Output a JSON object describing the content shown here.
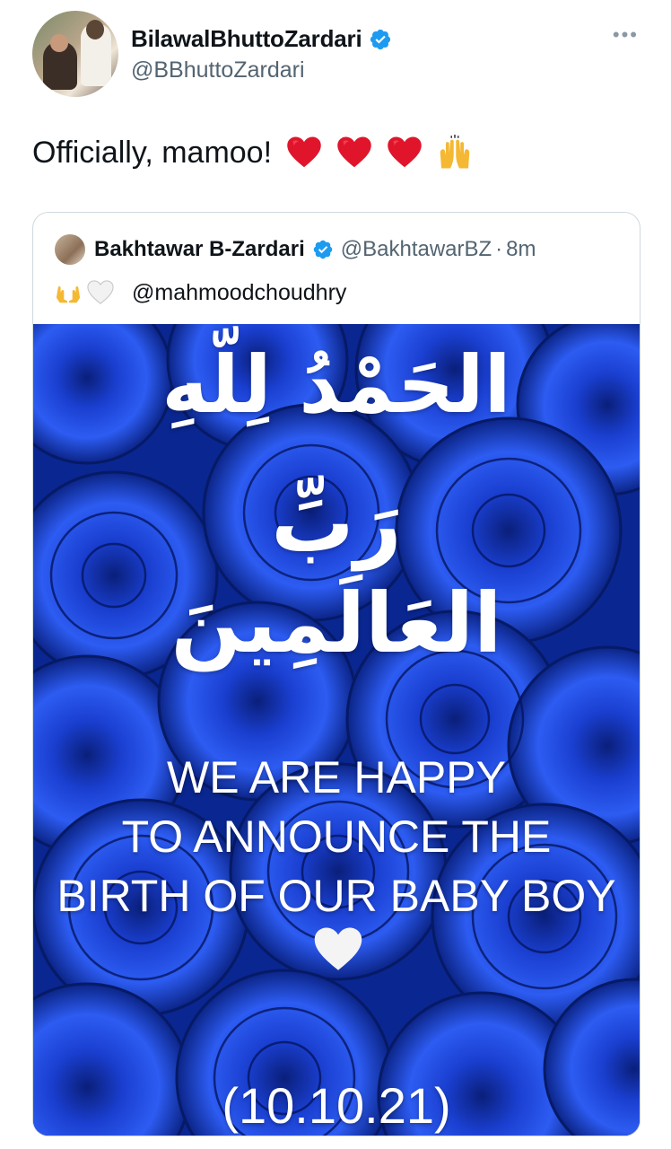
{
  "tweet": {
    "author": {
      "display_name": "BilawalBhuttoZardari",
      "handle": "@BBhuttoZardari",
      "verified": true
    },
    "more_icon": "more-icon",
    "text": "Officially, mamoo!",
    "text_emojis": [
      "red-heart",
      "red-heart",
      "red-heart",
      "raising-hands"
    ]
  },
  "quoted_tweet": {
    "author": {
      "display_name": "Bakhtawar B-Zardari",
      "handle": "@BakhtawarBZ",
      "separator": "·",
      "time": "8m",
      "verified": true
    },
    "body_emojis": [
      "palms-up-together",
      "white-heart"
    ],
    "mention": "@mahmoodchoudhry",
    "media": {
      "arabic_line_1": "الحَمْدُ لِلّهِ",
      "arabic_line_2": "رَبِّ",
      "arabic_line_3": "العَالَمِينَ",
      "announcement_line_1": "WE ARE HAPPY",
      "announcement_line_2": "TO ANNOUNCE THE",
      "announcement_line_3": "BIRTH OF OUR BABY BOY",
      "heart": "white-heart",
      "date": "(10.10.21)",
      "background": "blue roses",
      "background_color": "#0b2a9c"
    }
  },
  "colors": {
    "verified_blue": "#1d9bf0",
    "secondary_text": "#536471",
    "border": "#cfd9de",
    "heart_red": "#e0152b"
  }
}
